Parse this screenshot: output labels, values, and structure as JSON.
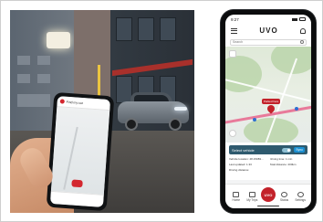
{
  "photo": {
    "held_phone": {
      "screen_title": "Find my car"
    }
  },
  "app": {
    "status_bar": {
      "time": "9:27"
    },
    "logo": "UVO",
    "search_placeholder": "Search",
    "map": {
      "poi_label": "Parked here"
    },
    "info_card": {
      "title": "Select vehicle",
      "action": "Sync",
      "lines": [
        "Vehicle location: 48.15083...",
        "Driving time: 1 min",
        "Last updated: 1.33",
        "Total distance: 200km",
        "Driving distance:",
        ""
      ]
    },
    "nav": [
      {
        "label": "Home",
        "icon": "home-icon"
      },
      {
        "label": "My Trips",
        "icon": "trips-icon"
      },
      {
        "label": "UVO",
        "icon": "uvo-icon"
      },
      {
        "label": "Status",
        "icon": "status-icon"
      },
      {
        "label": "Settings",
        "icon": "settings-icon"
      }
    ]
  },
  "colors": {
    "brand_red": "#c3222a",
    "card_header": "#2e5a6e",
    "route": "#e87a9a"
  }
}
